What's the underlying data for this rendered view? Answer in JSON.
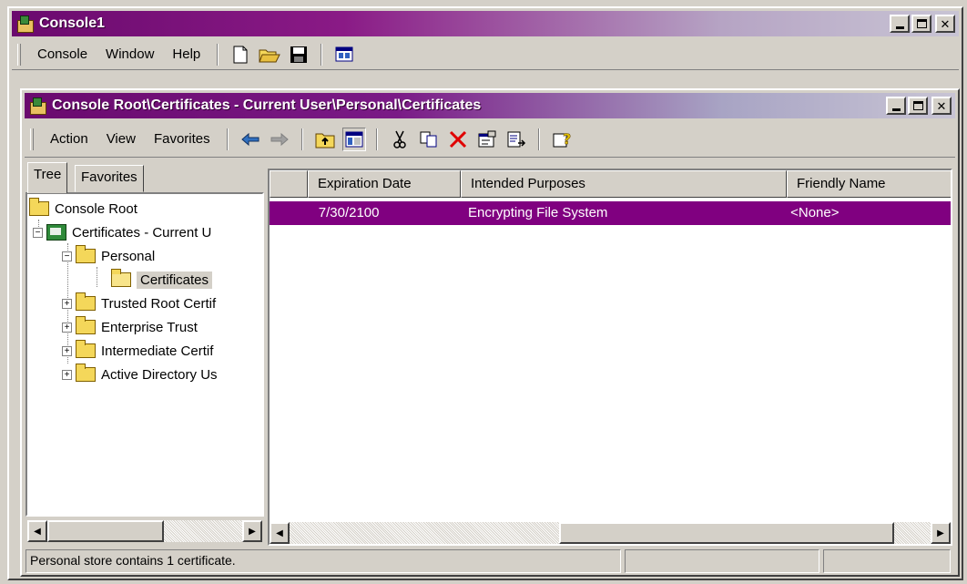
{
  "app": {
    "title": "Console1",
    "menu": [
      "Console",
      "Window",
      "Help"
    ]
  },
  "child": {
    "title": "Console Root\\Certificates - Current User\\Personal\\Certificates",
    "menu": [
      "Action",
      "View",
      "Favorites"
    ]
  },
  "tabs": [
    "Tree",
    "Favorites"
  ],
  "tree": {
    "items": [
      {
        "label": "Console Root"
      },
      {
        "label": "Certificates - Current U"
      },
      {
        "label": "Personal"
      },
      {
        "label": "Certificates"
      },
      {
        "label": "Trusted Root Certif"
      },
      {
        "label": "Enterprise Trust"
      },
      {
        "label": "Intermediate Certif"
      },
      {
        "label": "Active Directory Us"
      }
    ]
  },
  "list": {
    "columns": [
      "",
      "Expiration Date",
      "Intended Purposes",
      "Friendly Name"
    ],
    "rows": [
      {
        "expiration": "7/30/2100",
        "purposes": "Encrypting File System",
        "friendly": "<None>"
      }
    ]
  },
  "status": {
    "text": "Personal store contains 1 certificate."
  },
  "colors": {
    "selection": "#800080",
    "title_start": "#6a0a6e",
    "face": "#d4d0c8"
  }
}
